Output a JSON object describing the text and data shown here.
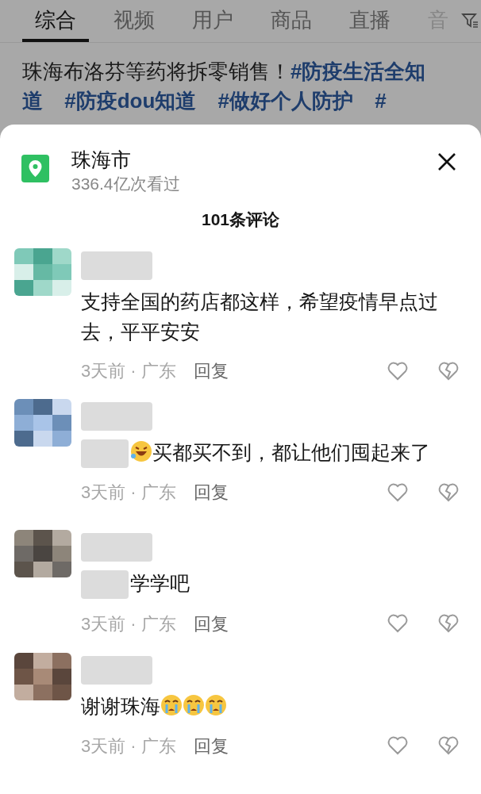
{
  "tabs": [
    {
      "label": "综合",
      "selected": true
    },
    {
      "label": "视频",
      "selected": false
    },
    {
      "label": "用户",
      "selected": false
    },
    {
      "label": "商品",
      "selected": false
    },
    {
      "label": "直播",
      "selected": false
    },
    {
      "label": "音",
      "selected": false
    }
  ],
  "post": {
    "text": "珠海布洛芬等药将拆零销售！",
    "hashtags": [
      "#防疫生活全知道",
      "#防疫dou知道",
      "#做好个人防护",
      "#"
    ]
  },
  "sheet": {
    "title": "珠海市",
    "views": "336.4亿次看过",
    "comment_count": "101条评论"
  },
  "comments": [
    {
      "content": [
        {
          "kind": "text",
          "text": "支持全国的药店都这样，希望疫情早点过去，平平安安"
        }
      ],
      "time": "3天前 · 广东",
      "reply": "回复"
    },
    {
      "content": [
        {
          "kind": "blur"
        },
        {
          "kind": "laugh"
        },
        {
          "kind": "text",
          "text": "买都买不到，都让他们囤起来了"
        }
      ],
      "time": "3天前 · 广东",
      "reply": "回复"
    },
    {
      "content": [
        {
          "kind": "blur"
        },
        {
          "kind": "text",
          "text": "学学吧"
        }
      ],
      "time": "3天前 · 广东",
      "reply": "回复"
    },
    {
      "content": [
        {
          "kind": "text",
          "text": "谢谢珠海"
        },
        {
          "kind": "cry"
        },
        {
          "kind": "cry"
        },
        {
          "kind": "cry"
        }
      ],
      "time": "3天前 · 广东",
      "reply": "回复"
    }
  ]
}
